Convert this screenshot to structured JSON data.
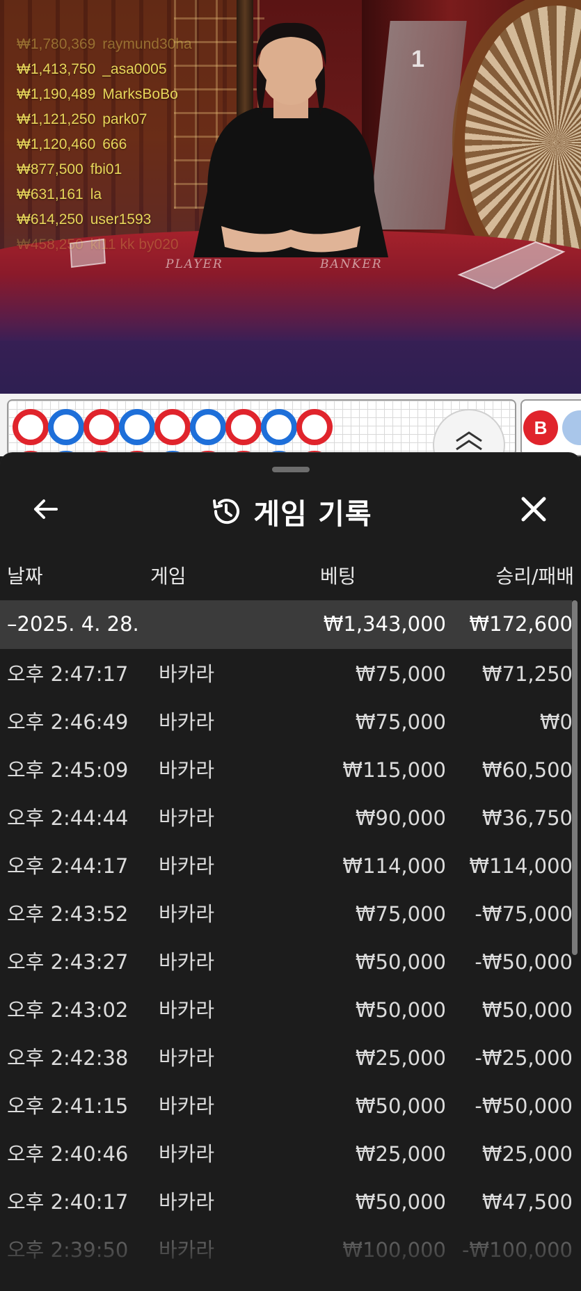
{
  "stream": {
    "round_number": "1",
    "felt_labels": [
      "PLAYER",
      "BANKER"
    ],
    "winners": [
      {
        "amount": "₩1,780,369",
        "user": "raymund30ha",
        "style": "faded"
      },
      {
        "amount": "₩1,413,750",
        "user": "_asa0005",
        "style": ""
      },
      {
        "amount": "₩1,190,489",
        "user": "MarksBoBo",
        "style": ""
      },
      {
        "amount": "₩1,121,250",
        "user": "park07",
        "style": ""
      },
      {
        "amount": "₩1,120,460",
        "user": "666",
        "style": ""
      },
      {
        "amount": "₩877,500",
        "user": "fbi01",
        "style": ""
      },
      {
        "amount": "₩631,161",
        "user": "la",
        "style": ""
      },
      {
        "amount": "₩614,250",
        "user": "user1593",
        "style": ""
      },
      {
        "amount": "₩458,250",
        "user": "kl11 kk by020",
        "style": "faded2"
      }
    ]
  },
  "roadmap": {
    "beads": [
      "B",
      "P",
      "B",
      "P",
      "B",
      "P",
      "B",
      "P",
      "B"
    ],
    "badge": "B",
    "colors": {
      "banker": "#e0242c",
      "player": "#1e6fd9"
    }
  },
  "history": {
    "title": "게임 기록",
    "icons": {
      "back": "arrow-left-icon",
      "title": "history-clock-icon",
      "close": "close-x-icon"
    },
    "columns": {
      "date": "날짜",
      "game": "게임",
      "bet": "베팅",
      "result": "승리/패배"
    },
    "date_group": {
      "date": "–2025. 4. 28.",
      "bet_total": "₩1,343,000",
      "result_total": "₩172,600"
    },
    "rows": [
      {
        "time": "오후 2:47:17",
        "game": "바카라",
        "bet": "₩75,000",
        "result": "₩71,250"
      },
      {
        "time": "오후 2:46:49",
        "game": "바카라",
        "bet": "₩75,000",
        "result": "₩0"
      },
      {
        "time": "오후 2:45:09",
        "game": "바카라",
        "bet": "₩115,000",
        "result": "₩60,500"
      },
      {
        "time": "오후 2:44:44",
        "game": "바카라",
        "bet": "₩90,000",
        "result": "₩36,750"
      },
      {
        "time": "오후 2:44:17",
        "game": "바카라",
        "bet": "₩114,000",
        "result": "₩114,000"
      },
      {
        "time": "오후 2:43:52",
        "game": "바카라",
        "bet": "₩75,000",
        "result": "-₩75,000"
      },
      {
        "time": "오후 2:43:27",
        "game": "바카라",
        "bet": "₩50,000",
        "result": "-₩50,000"
      },
      {
        "time": "오후 2:43:02",
        "game": "바카라",
        "bet": "₩50,000",
        "result": "₩50,000"
      },
      {
        "time": "오후 2:42:38",
        "game": "바카라",
        "bet": "₩25,000",
        "result": "-₩25,000"
      },
      {
        "time": "오후 2:41:15",
        "game": "바카라",
        "bet": "₩50,000",
        "result": "-₩50,000"
      },
      {
        "time": "오후 2:40:46",
        "game": "바카라",
        "bet": "₩25,000",
        "result": "₩25,000"
      },
      {
        "time": "오후 2:40:17",
        "game": "바카라",
        "bet": "₩50,000",
        "result": "₩47,500"
      },
      {
        "time": "오후 2:39:50",
        "game": "바카라",
        "bet": "₩100,000",
        "result": "-₩100,000"
      }
    ]
  }
}
